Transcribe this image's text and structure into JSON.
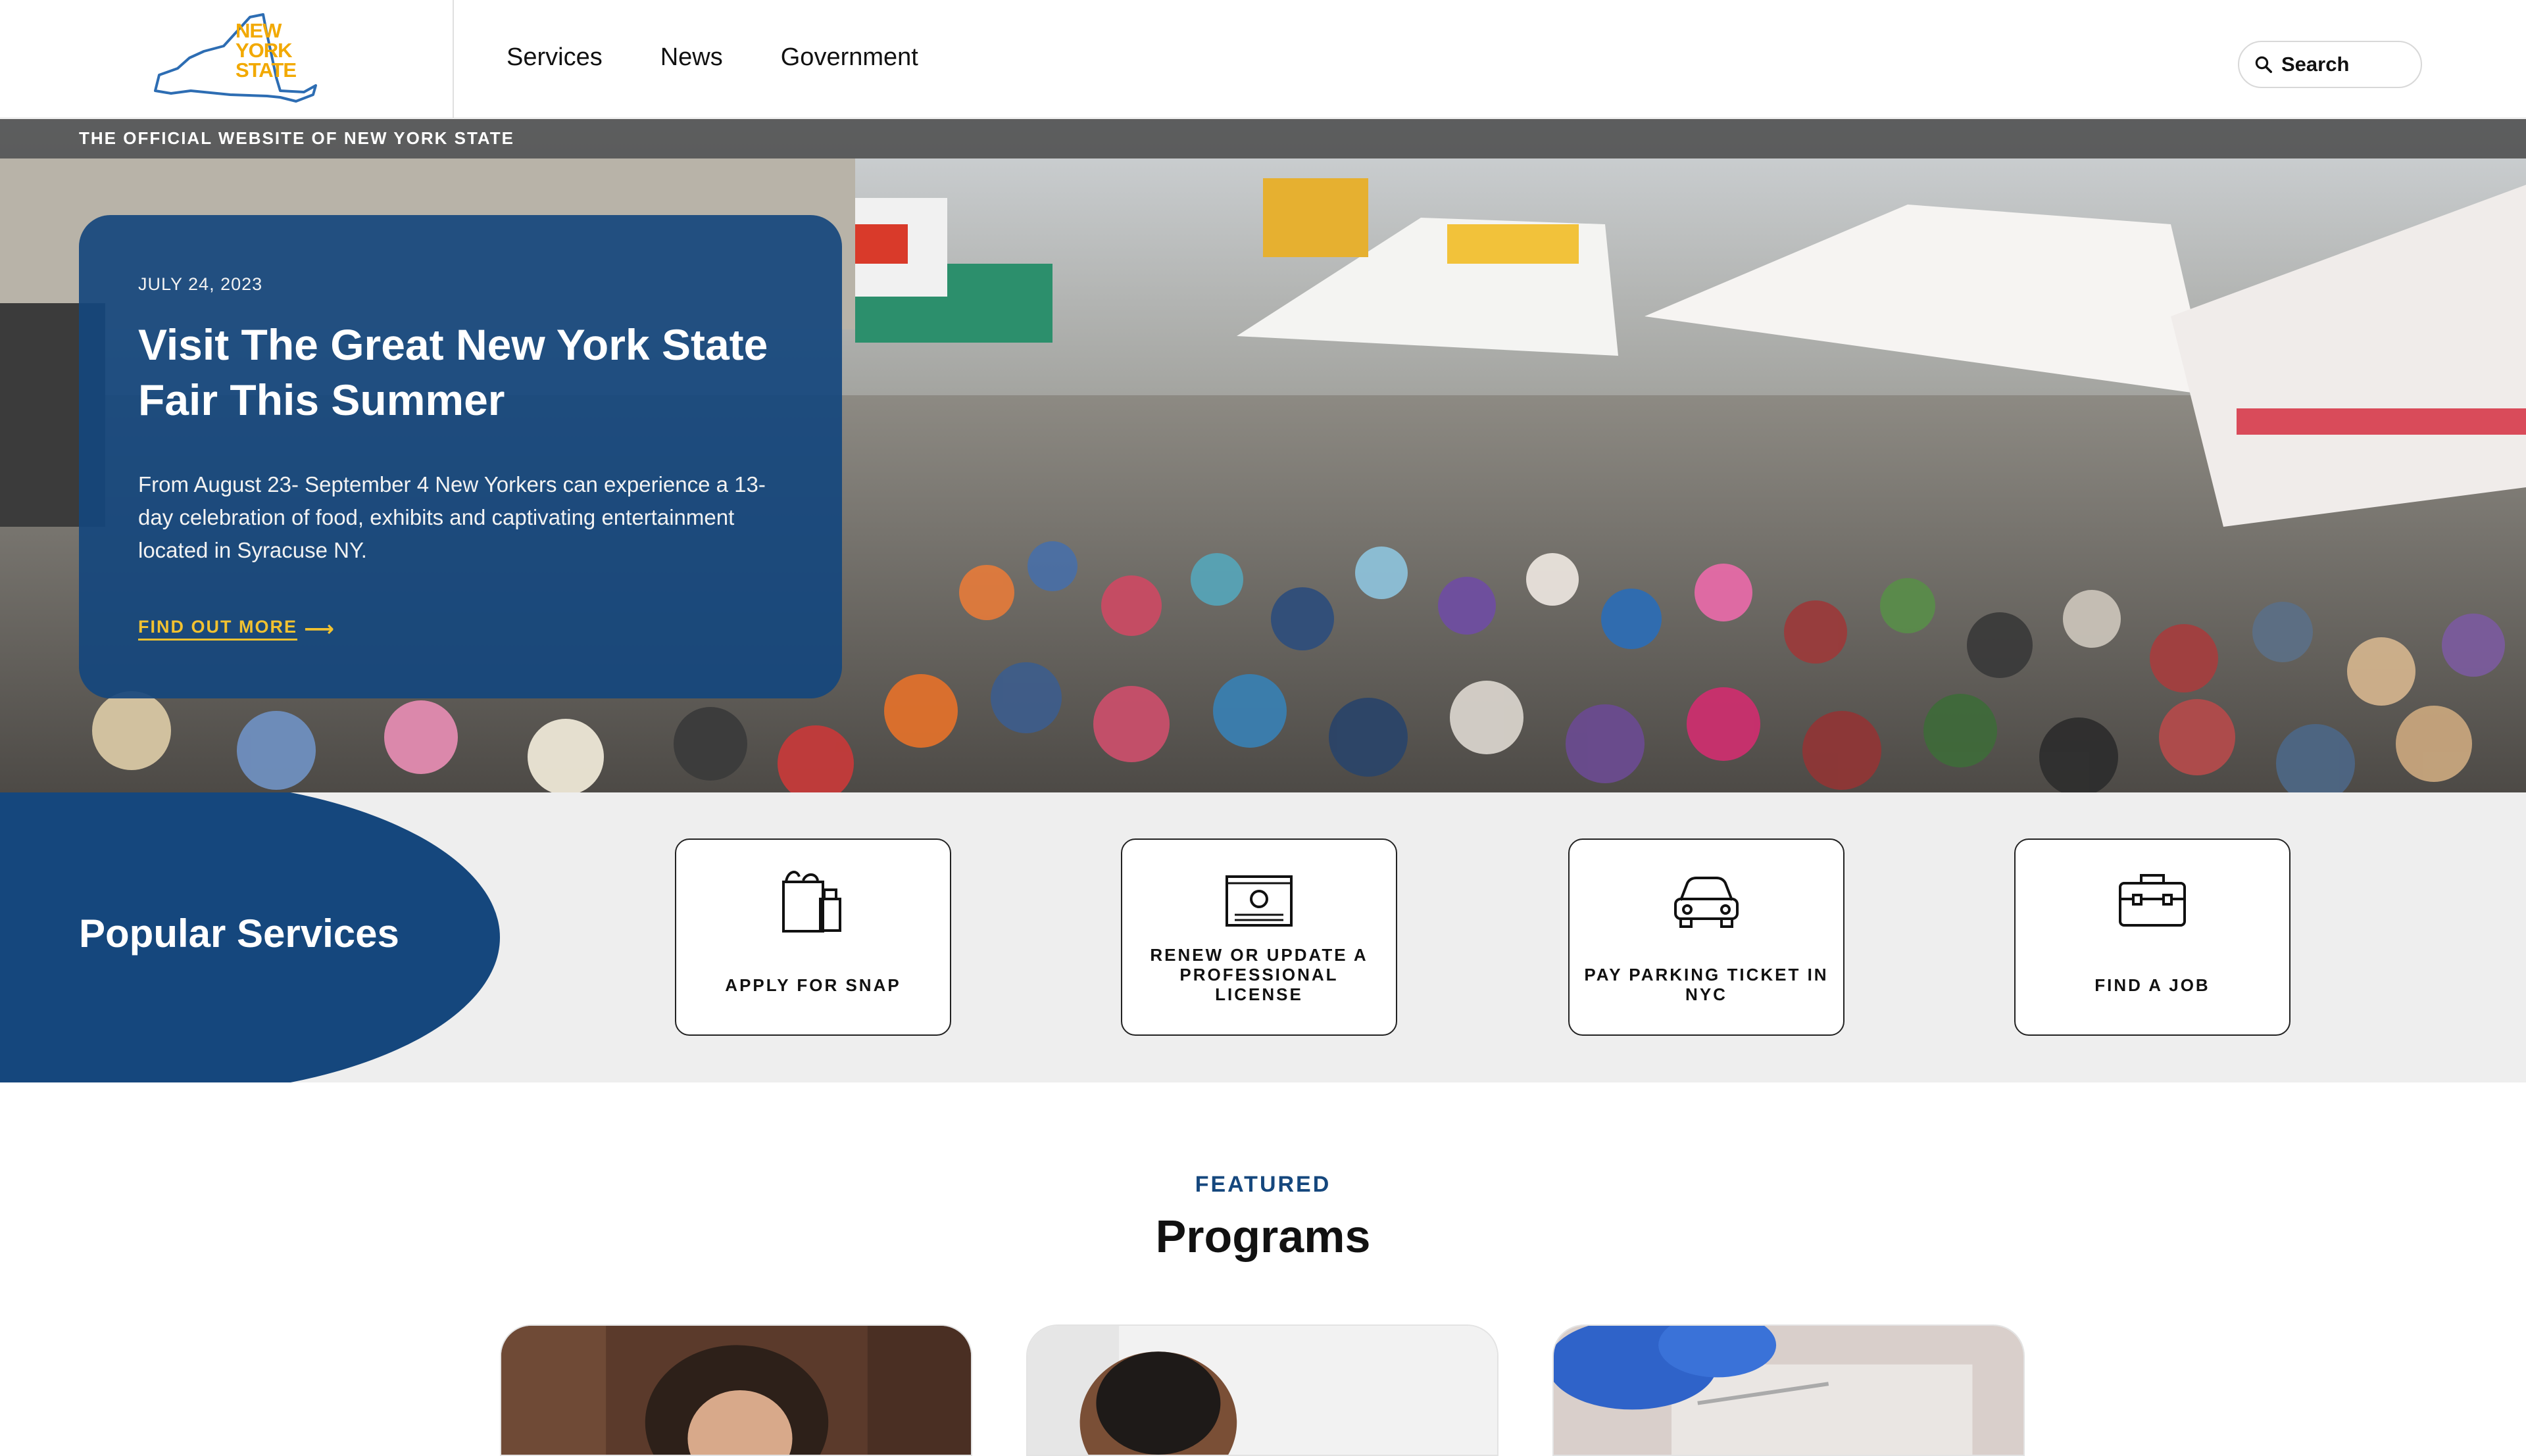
{
  "header": {
    "logo_text": [
      "NEW",
      "YORK",
      "STATE"
    ],
    "nav": [
      {
        "label": "Services"
      },
      {
        "label": "News"
      },
      {
        "label": "Government"
      }
    ],
    "search": {
      "label": "Search"
    }
  },
  "hero": {
    "official_banner": "THE OFFICIAL WEBSITE OF NEW YORK STATE",
    "date": "JULY 24, 2023",
    "title": "Visit The Great New York State Fair This Summer",
    "description": "From August 23- September 4 New Yorkers can experience a 13-day celebration of food, exhibits and captivating entertainment located in Syracuse NY.",
    "cta": "FIND OUT MORE",
    "cta_icon": "arrow-right-icon"
  },
  "popular_services": {
    "title": "Popular Services",
    "items": [
      {
        "label": "APPLY FOR SNAP",
        "icon": "grocery-bag-icon"
      },
      {
        "label": "RENEW OR UPDATE A PROFESSIONAL LICENSE",
        "icon": "license-certificate-icon"
      },
      {
        "label": "PAY PARKING TICKET IN NYC",
        "icon": "car-icon"
      },
      {
        "label": "FIND A JOB",
        "icon": "briefcase-icon"
      }
    ]
  },
  "featured": {
    "eyebrow": "FEATURED",
    "title": "Programs"
  },
  "colors": {
    "brand_blue": "#15477d",
    "accent_yellow": "#f2c230",
    "logo_yellow": "#f2a900",
    "services_bg": "#eeeeee"
  }
}
